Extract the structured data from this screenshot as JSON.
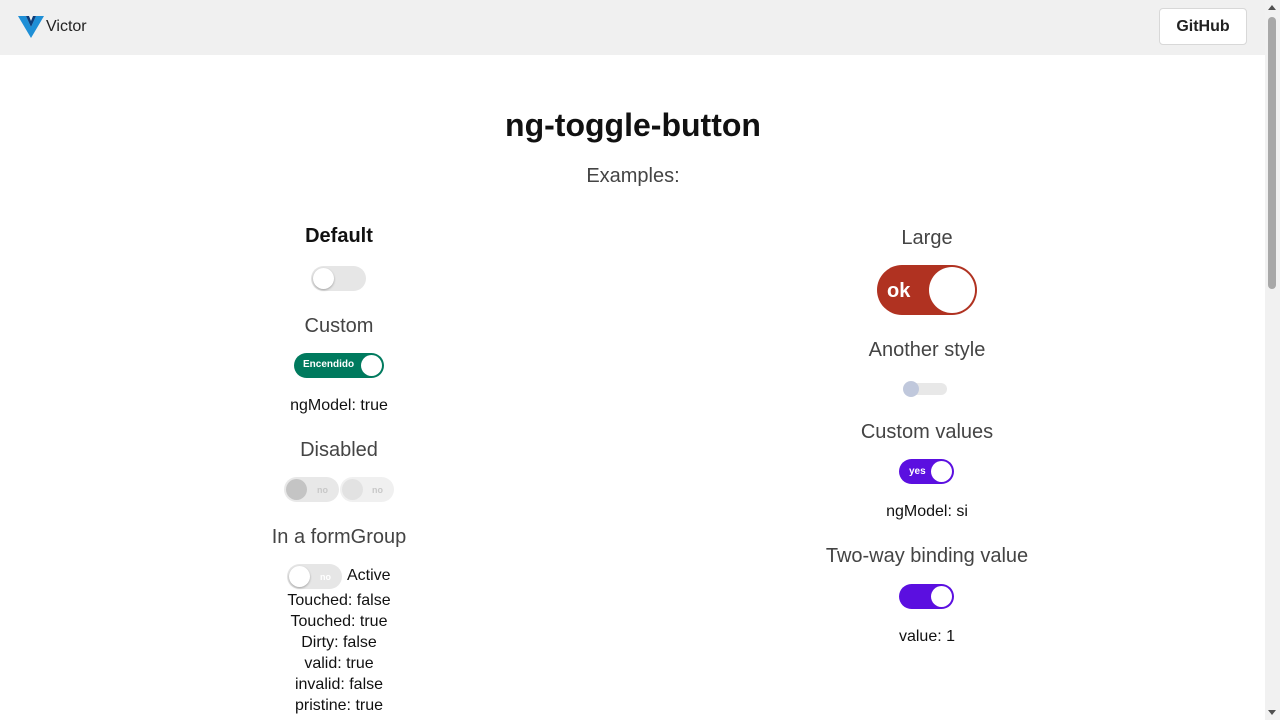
{
  "header": {
    "brand": "Victor",
    "github_label": "GitHub"
  },
  "page": {
    "title": "ng-toggle-button",
    "subtitle": "Examples:"
  },
  "left": {
    "default": {
      "title": "Default",
      "checked": false
    },
    "custom": {
      "title": "Custom",
      "on_label": "Encendido",
      "checked": true,
      "ngmodel": "ngModel: true",
      "color": "#007a5e"
    },
    "disabled": {
      "title": "Disabled",
      "off_label_1": "no",
      "off_label_2": "no"
    },
    "formgroup": {
      "title": "In a formGroup",
      "off_label": "no",
      "active_label": "Active",
      "status": [
        "Touched: false",
        "Touched: true",
        "Dirty: false",
        "valid: true",
        "invalid: false",
        "pristine: true"
      ]
    }
  },
  "right": {
    "large": {
      "title": "Large",
      "on_label": "ok",
      "checked": true,
      "color": "#b03221"
    },
    "another": {
      "title": "Another style",
      "checked": false
    },
    "custom_values": {
      "title": "Custom values",
      "on_label": "yes",
      "checked": true,
      "ngmodel": "ngModel: si",
      "color": "#5b0fe0"
    },
    "two_way": {
      "title": "Two-way binding value",
      "checked": true,
      "value_text": "value: 1",
      "color": "#5b0fe0"
    }
  }
}
